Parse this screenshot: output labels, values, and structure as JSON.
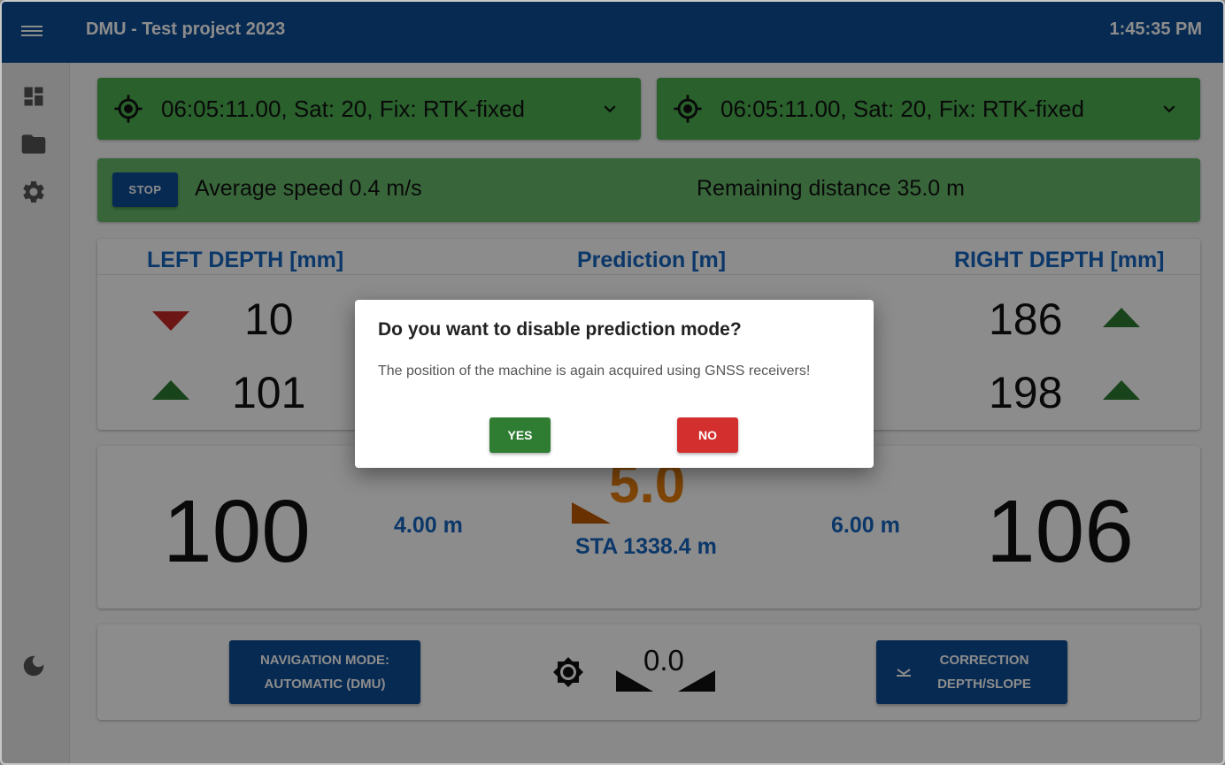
{
  "header": {
    "title": "DMU - Test project 2023",
    "clock": "1:45:35 PM"
  },
  "sidebar": {
    "items": [
      {
        "icon": "dashboard-icon"
      },
      {
        "icon": "folder-icon"
      },
      {
        "icon": "gear-icon"
      },
      {
        "icon": "dark-mode-icon"
      }
    ]
  },
  "gnss": {
    "left": "06:05:11.00, Sat: 20, Fix: RTK-fixed",
    "right": "06:05:11.00, Sat: 20, Fix: RTK-fixed"
  },
  "status": {
    "stop_label": "STOP",
    "average_speed": "Average speed 0.4 m/s",
    "remaining_distance": "Remaining distance 35.0 m"
  },
  "depth": {
    "left_header": "LEFT DEPTH [mm]",
    "prediction_header": "Prediction [m]",
    "right_header": "RIGHT DEPTH [mm]",
    "left_top": "10",
    "left_bottom": "101",
    "right_top": "186",
    "right_bottom": "198"
  },
  "main": {
    "left_value": "100",
    "left_distance": "4.00 m",
    "prediction_value": "5.0",
    "station": "STA 1338.4 m",
    "right_distance": "6.00 m",
    "right_value": "106"
  },
  "bottom": {
    "nav_mode_line1": "NAVIGATION MODE:",
    "nav_mode_line2": "AUTOMATIC (DMU)",
    "slope_value": "0.0",
    "correction_line1": "CORRECTION",
    "correction_line2": "DEPTH/SLOPE"
  },
  "dialog": {
    "title": "Do you want to disable prediction mode?",
    "message": "The position of the machine is again acquired using GNSS receivers!",
    "yes_label": "YES",
    "no_label": "NO"
  },
  "colors": {
    "brand": "#0d4d96",
    "gnss_green": "#4caf50",
    "accent_blue": "#1565c0",
    "prediction_orange": "#e67e0e",
    "yes_green": "#2e7d32",
    "no_red": "#d32f2f"
  }
}
